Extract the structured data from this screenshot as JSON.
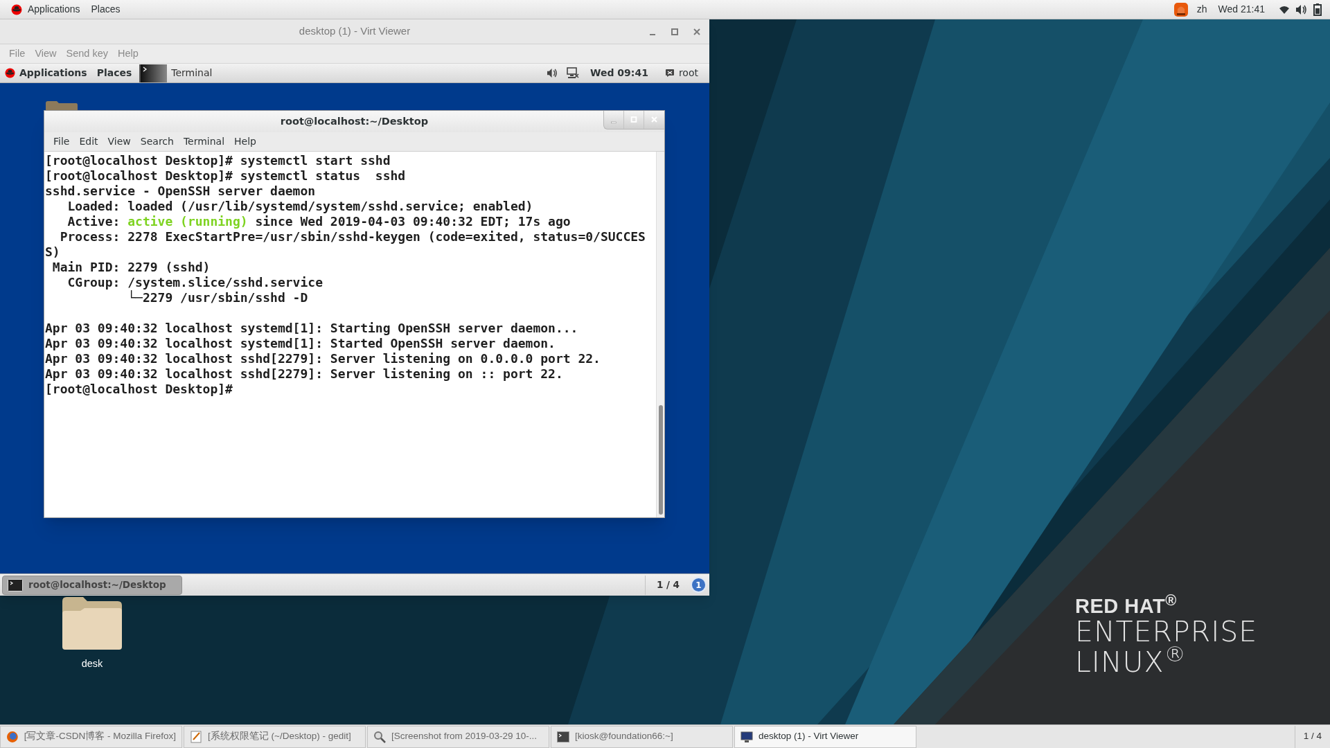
{
  "top_bar": {
    "menus": [
      {
        "label": "Applications"
      },
      {
        "label": "Places"
      }
    ],
    "language": "zh",
    "clock": "Wed 21:41"
  },
  "virt_viewer": {
    "title": "desktop (1) - Virt Viewer",
    "menu": [
      "File",
      "View",
      "Send key",
      "Help"
    ],
    "guest": {
      "top_bar": {
        "menus": [
          "Applications",
          "Places"
        ],
        "task": "Terminal",
        "clock": "Wed 09:41",
        "user": "root"
      },
      "terminal": {
        "title": "root@localhost:~/Desktop",
        "menu": [
          "File",
          "Edit",
          "View",
          "Search",
          "Terminal",
          "Help"
        ],
        "lines": [
          {
            "gap_before": false,
            "segments": [
              {
                "text": "[root@localhost Desktop]# systemctl start sshd"
              }
            ]
          },
          {
            "gap_before": false,
            "segments": [
              {
                "text": "[root@localhost Desktop]# systemctl status  sshd"
              }
            ]
          },
          {
            "gap_before": false,
            "segments": [
              {
                "text": "sshd.service - OpenSSH server daemon"
              }
            ]
          },
          {
            "gap_before": false,
            "segments": [
              {
                "text": "   Loaded: loaded (/usr/lib/systemd/system/sshd.service; enabled)"
              }
            ]
          },
          {
            "gap_before": false,
            "segments": [
              {
                "text": "   Active: "
              },
              {
                "text": "active (running)",
                "color": "#7ed321"
              },
              {
                "text": " since Wed 2019-04-03 09:40:32 EDT; 17s ago"
              }
            ]
          },
          {
            "gap_before": false,
            "segments": [
              {
                "text": "  Process: 2278 ExecStartPre=/usr/sbin/sshd-keygen (code=exited, status=0/SUCCES"
              }
            ]
          },
          {
            "gap_before": false,
            "segments": [
              {
                "text": "S)"
              }
            ]
          },
          {
            "gap_before": false,
            "segments": [
              {
                "text": " Main PID: 2279 (sshd)"
              }
            ]
          },
          {
            "gap_before": false,
            "segments": [
              {
                "text": "   CGroup: /system.slice/sshd.service"
              }
            ]
          },
          {
            "gap_before": false,
            "segments": [
              {
                "text": "           └─2279 /usr/sbin/sshd -D"
              }
            ]
          },
          {
            "gap_before": true,
            "segments": [
              {
                "text": "Apr 03 09:40:32 localhost systemd[1]: Starting OpenSSH server daemon..."
              }
            ]
          },
          {
            "gap_before": false,
            "segments": [
              {
                "text": "Apr 03 09:40:32 localhost systemd[1]: Started OpenSSH server daemon."
              }
            ]
          },
          {
            "gap_before": false,
            "segments": [
              {
                "text": "Apr 03 09:40:32 localhost sshd[2279]: Server listening on 0.0.0.0 port 22."
              }
            ]
          },
          {
            "gap_before": false,
            "segments": [
              {
                "text": "Apr 03 09:40:32 localhost sshd[2279]: Server listening on :: port 22."
              }
            ]
          },
          {
            "gap_before": false,
            "segments": [
              {
                "text": "[root@localhost Desktop]# "
              }
            ]
          }
        ]
      },
      "bottom_bar": {
        "tasks": [
          {
            "label": "root@localhost:~/Desktop",
            "selected": true
          }
        ],
        "workspace": "1 / 4",
        "badge": "1"
      }
    }
  },
  "desktop_icons": [
    {
      "label": "desk"
    }
  ],
  "branding": {
    "lines": [
      "RED HAT$^{®}$",
      "ENTERPRISE",
      "LINUX$^{®}$"
    ]
  },
  "taskbar": {
    "items": [
      {
        "kind": "browser",
        "label": "[写文章-CSDN博客 - Mozilla Firefox]",
        "selected": false
      },
      {
        "kind": "editor",
        "label": "[系统权限笔记 (~/Desktop) - gedit]",
        "selected": false
      },
      {
        "kind": "screenshot",
        "label": "[Screenshot from 2019-03-29 10-...",
        "selected": false
      },
      {
        "kind": "terminal",
        "label": "[kiosk@foundation66:~]",
        "selected": false
      },
      {
        "kind": "viewer",
        "label": "desktop (1) - Virt Viewer",
        "selected": true
      }
    ],
    "workspace": "1 / 4"
  }
}
